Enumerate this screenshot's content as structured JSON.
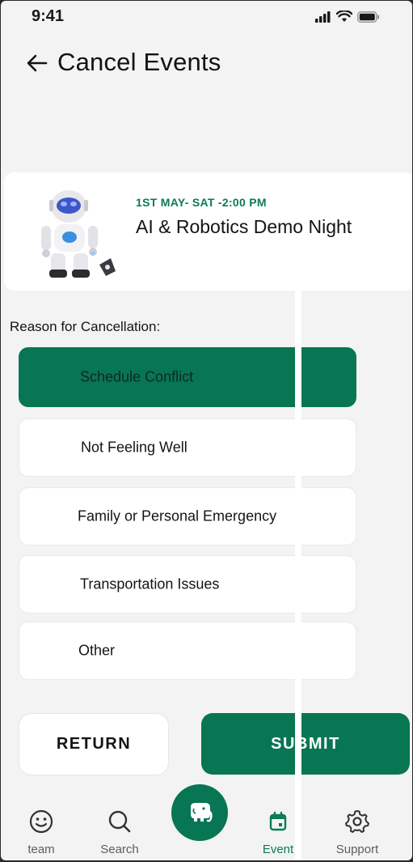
{
  "status_bar": {
    "time": "9:41"
  },
  "header": {
    "title": "Cancel Events"
  },
  "event": {
    "date": "1ST  MAY- SAT -2:00 PM",
    "title": "AI & Robotics Demo Night"
  },
  "reasons": {
    "label": "Reason for Cancellation:",
    "options": [
      {
        "label": "Schedule Conflict",
        "selected": true
      },
      {
        "label": "Not Feeling Well",
        "selected": false
      },
      {
        "label": "Family or Personal Emergency",
        "selected": false
      },
      {
        "label": "Transportation Issues",
        "selected": false
      },
      {
        "label": "Other",
        "selected": false
      }
    ]
  },
  "actions": {
    "return_label": "RETURN",
    "submit_label": "SUBMIT"
  },
  "nav": {
    "items": [
      {
        "label": "team",
        "icon": "smiley-icon",
        "active": false
      },
      {
        "label": "Search",
        "icon": "search-icon",
        "active": false
      },
      {
        "label": "Event",
        "icon": "calendar-icon",
        "active": true
      },
      {
        "label": "Support",
        "icon": "gear-icon",
        "active": false
      }
    ],
    "center_icon": "elephant-icon"
  },
  "colors": {
    "accent": "#087553",
    "accent_text": "#0c7a57",
    "background": "#f3f3f3"
  }
}
